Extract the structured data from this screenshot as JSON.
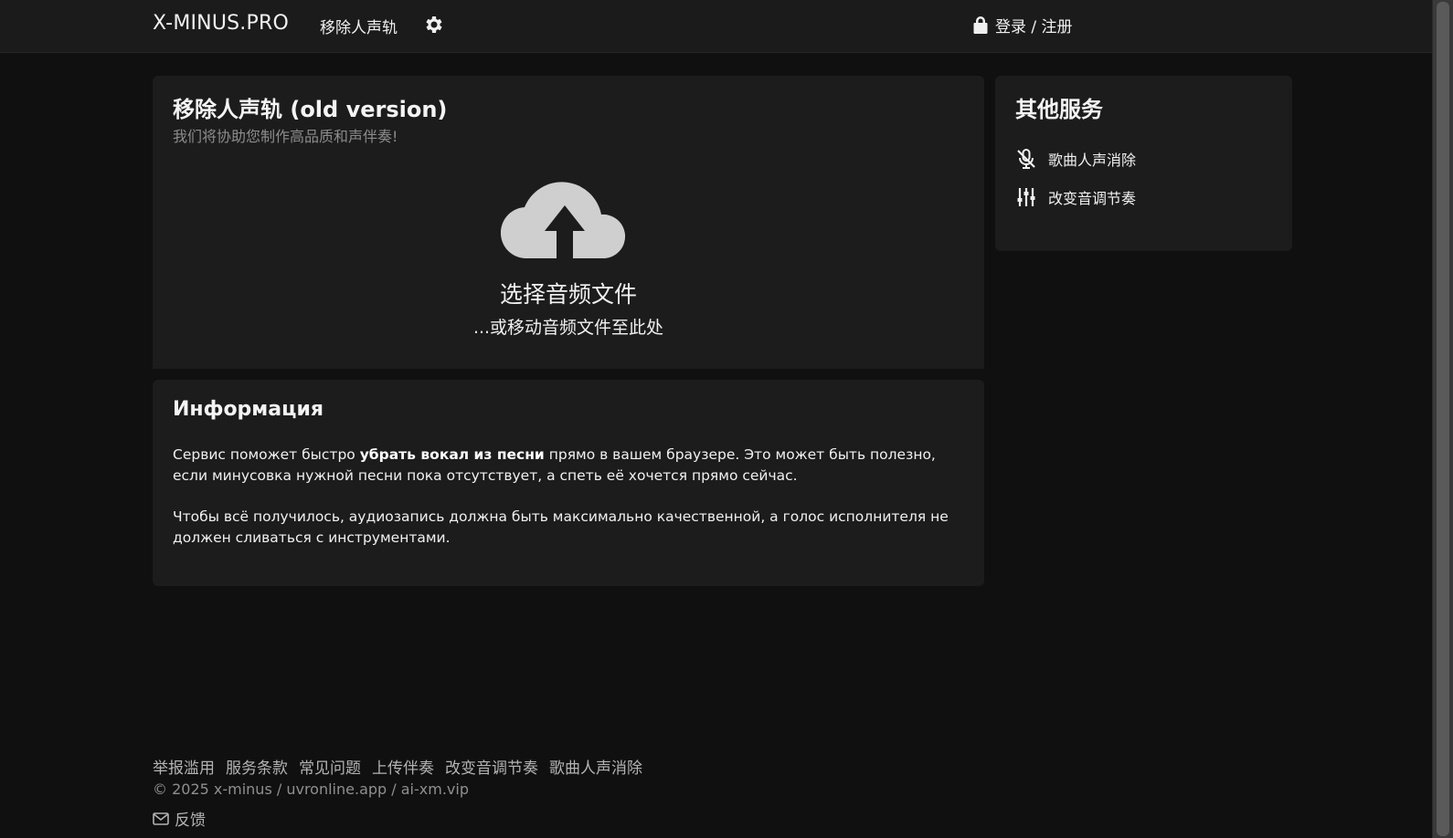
{
  "header": {
    "brand": "X-MINUS.PRO",
    "nav_link": "移除人声轨",
    "settings_icon": "gear-icon",
    "login_icon": "lock-icon",
    "login_label": "登录 / 注册"
  },
  "upload": {
    "title": "移除人声轨 (old version)",
    "subtitle": "我们将协助您制作高品质和声伴奏!",
    "icon": "cloud-upload-icon",
    "cta_main": "选择音频文件",
    "cta_sub": "...或移动音频文件至此处"
  },
  "info": {
    "title": "Информация",
    "p1_before": "Сервис поможет быстро ",
    "p1_bold": "убрать вокал из песни",
    "p1_after": " прямо в вашем браузере. Это может быть полезно, если минусовка нужной песни пока отсутствует, а спеть её хочется прямо сейчас.",
    "p2": "Чтобы всё получилось, аудиозапись должна быть максимально качественной, а голос исполнителя не должен сливаться с инструментами."
  },
  "services": {
    "title": "其他服务",
    "items": [
      {
        "label": "歌曲人声消除",
        "icon": "microphone-slash-icon"
      },
      {
        "label": "改变音调节奏",
        "icon": "sliders-icon"
      }
    ]
  },
  "footer": {
    "links": [
      "举报滥用",
      "服务条款",
      "常见问题",
      "上传伴奏",
      "改变音调节奏",
      "歌曲人声消除"
    ],
    "copyright": "© 2025 x-minus / uvronline.app / ai-xm.vip",
    "feedback_icon": "envelope-icon",
    "feedback_label": "反馈"
  },
  "colors": {
    "background": "#101010",
    "card": "#1c1c1c",
    "header": "#1b1b1b",
    "icon_gray": "#cfcfcf"
  }
}
